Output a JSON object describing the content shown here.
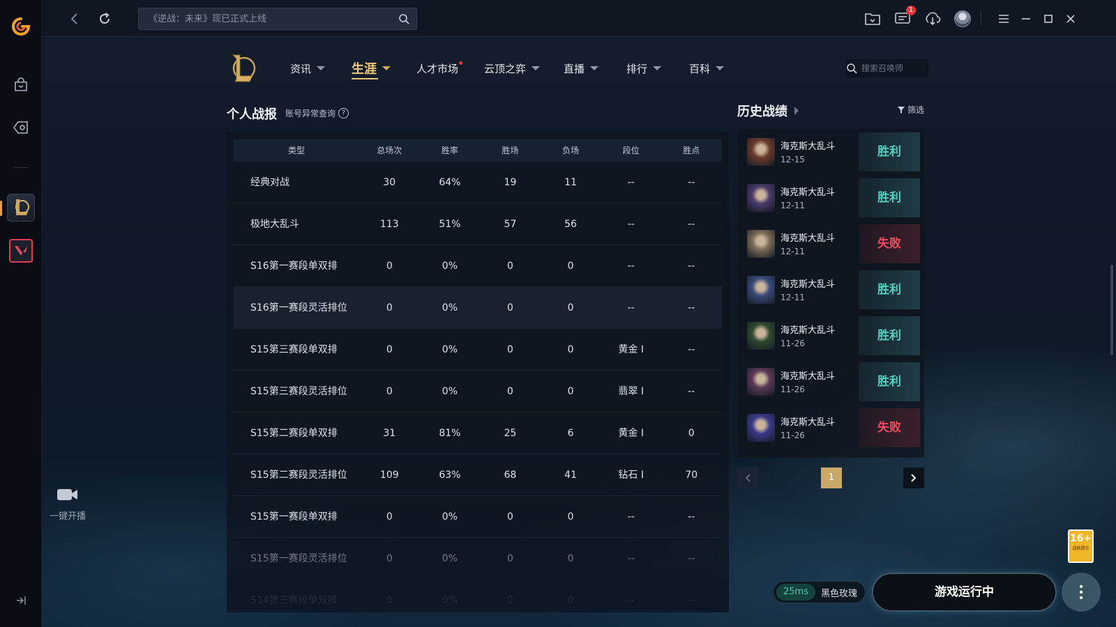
{
  "topbar": {
    "search_placeholder": "《逆战：未来》现已正式上线",
    "notif_badge": "1"
  },
  "rail": {
    "live_label": "一键开播"
  },
  "game_nav": {
    "items": [
      {
        "label": "资讯"
      },
      {
        "label": "生涯"
      },
      {
        "label": "人才市场"
      },
      {
        "label": "云顶之弈"
      },
      {
        "label": "直播"
      },
      {
        "label": "排行"
      },
      {
        "label": "百科"
      }
    ],
    "summoner_search_placeholder": "搜索召唤师"
  },
  "record": {
    "title": "个人战报",
    "link": "账号异常查询",
    "help": "?",
    "headers": [
      "类型",
      "总场次",
      "胜率",
      "胜场",
      "负场",
      "段位",
      "胜点"
    ],
    "rows": [
      [
        "经典对战",
        "30",
        "64%",
        "19",
        "11",
        "--",
        "--"
      ],
      [
        "极地大乱斗",
        "113",
        "51%",
        "57",
        "56",
        "--",
        "--"
      ],
      [
        "S16第一赛段单双排",
        "0",
        "0%",
        "0",
        "0",
        "--",
        "--"
      ],
      [
        "S16第一赛段灵活排位",
        "0",
        "0%",
        "0",
        "0",
        "--",
        "--"
      ],
      [
        "S15第三赛段单双排",
        "0",
        "0%",
        "0",
        "0",
        "黄金 I",
        "--"
      ],
      [
        "S15第三赛段灵活排位",
        "0",
        "0%",
        "0",
        "0",
        "翡翠 I",
        "--"
      ],
      [
        "S15第二赛段单双排",
        "31",
        "81%",
        "25",
        "6",
        "黄金 I",
        "0"
      ],
      [
        "S15第二赛段灵活排位",
        "109",
        "63%",
        "68",
        "41",
        "钻石 I",
        "70"
      ],
      [
        "S15第一赛段单双排",
        "0",
        "0%",
        "0",
        "0",
        "--",
        "--"
      ],
      [
        "S15第一赛段灵活排位",
        "0",
        "0%",
        "0",
        "0",
        "--",
        "--"
      ],
      [
        "S14第三赛段单双排",
        "0",
        "0%",
        "0",
        "0",
        "--",
        "--"
      ]
    ]
  },
  "history": {
    "title": "历史战绩",
    "filter_label": "筛选",
    "matches": [
      {
        "mode": "海克斯大乱斗",
        "date": "12-15",
        "result": "胜利",
        "win": true,
        "color": "#6a3a2a"
      },
      {
        "mode": "海克斯大乱斗",
        "date": "12-11",
        "result": "胜利",
        "win": true,
        "color": "#4a3a6a"
      },
      {
        "mode": "海克斯大乱斗",
        "date": "12-11",
        "result": "失败",
        "win": false,
        "color": "#7a6a55"
      },
      {
        "mode": "海克斯大乱斗",
        "date": "12-11",
        "result": "胜利",
        "win": true,
        "color": "#3a4a7a"
      },
      {
        "mode": "海克斯大乱斗",
        "date": "11-26",
        "result": "胜利",
        "win": true,
        "color": "#2f4a30"
      },
      {
        "mode": "海克斯大乱斗",
        "date": "11-26",
        "result": "胜利",
        "win": true,
        "color": "#5a3a55"
      },
      {
        "mode": "海克斯大乱斗",
        "date": "11-26",
        "result": "失败",
        "win": false,
        "color": "#3a3a8a"
      }
    ],
    "page": "1"
  },
  "footer": {
    "ping": "25ms",
    "server": "黑色玫瑰",
    "launch_label": "游戏运行中",
    "age_rating": "16+",
    "age_note": "适龄提示"
  }
}
